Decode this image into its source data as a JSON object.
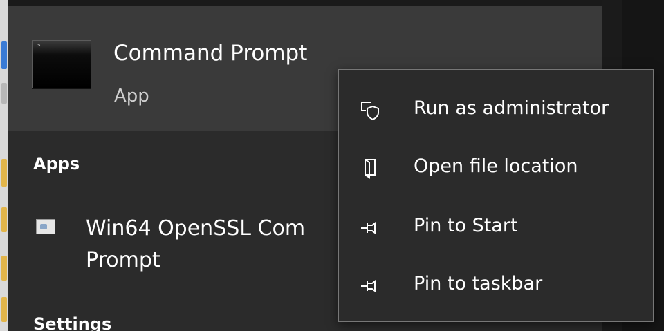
{
  "best_match": {
    "title": "Command Prompt",
    "type": "App",
    "icon": "command-prompt-icon"
  },
  "sections": {
    "apps": "Apps",
    "settings": "Settings"
  },
  "apps": [
    {
      "label": "Win64 OpenSSL Command Prompt",
      "visible_line1": "Win64 OpenSSL Com",
      "visible_line2": "Prompt",
      "icon": "openssl-app-icon"
    }
  ],
  "context_menu": {
    "items": [
      {
        "label": "Run as administrator",
        "icon": "run-as-admin-shield-icon"
      },
      {
        "label": "Open file location",
        "icon": "open-file-location-icon"
      },
      {
        "label": "Pin to Start",
        "icon": "pin-icon"
      },
      {
        "label": "Pin to taskbar",
        "icon": "pin-icon"
      }
    ]
  },
  "colors": {
    "panel": "#2b2b2b",
    "best_match_bg": "#3a3a3a",
    "menu_border": "#777777",
    "text": "#ffffff",
    "subtext": "#cfcfcf"
  }
}
